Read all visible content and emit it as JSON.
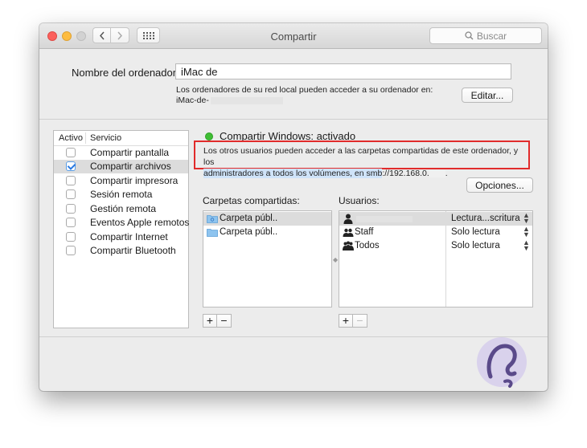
{
  "window": {
    "title": "Compartir",
    "search_placeholder": "Buscar"
  },
  "computer": {
    "label": "Nombre del ordenador:",
    "name_value": "iMac de",
    "description_line1": "Los ordenadores de su red local pueden acceder a su ordenador en:",
    "description_line2": "iMac-de-",
    "edit_button": "Editar..."
  },
  "services": {
    "header_active": "Activo",
    "header_service": "Servicio",
    "items": [
      {
        "label": "Compartir pantalla",
        "checked": false
      },
      {
        "label": "Compartir archivos",
        "checked": true
      },
      {
        "label": "Compartir impresora",
        "checked": false
      },
      {
        "label": "Sesión remota",
        "checked": false
      },
      {
        "label": "Gestión remota",
        "checked": false
      },
      {
        "label": "Eventos Apple remotos",
        "checked": false
      },
      {
        "label": "Compartir Internet",
        "checked": false
      },
      {
        "label": "Compartir Bluetooth",
        "checked": false
      }
    ]
  },
  "status": {
    "text": "Compartir Windows: activado",
    "color": "#3fbe35"
  },
  "info": {
    "line1": "Los otros usuarios pueden acceder a las carpetas compartidas de este ordenador, y los",
    "line2_highlight": "administradores a todos los volúmenes, en smb",
    "line2_rest": "://192.168.0.",
    "line2_end": "."
  },
  "options_button": "Opciones...",
  "folders": {
    "label": "Carpetas compartidas:",
    "items": [
      "Carpeta públ..",
      "Carpeta públ.."
    ]
  },
  "users": {
    "label": "Usuarios:",
    "items": [
      {
        "name": "",
        "permission": "Lectura...scritura"
      },
      {
        "name": "Staff",
        "permission": "Solo lectura"
      },
      {
        "name": "Todos",
        "permission": "Solo lectura"
      }
    ]
  },
  "controls": {
    "add": "+",
    "remove": "−"
  },
  "colors": {
    "highlight_box": "#e12b2b",
    "selection_highlight": "#cfe3f9"
  }
}
